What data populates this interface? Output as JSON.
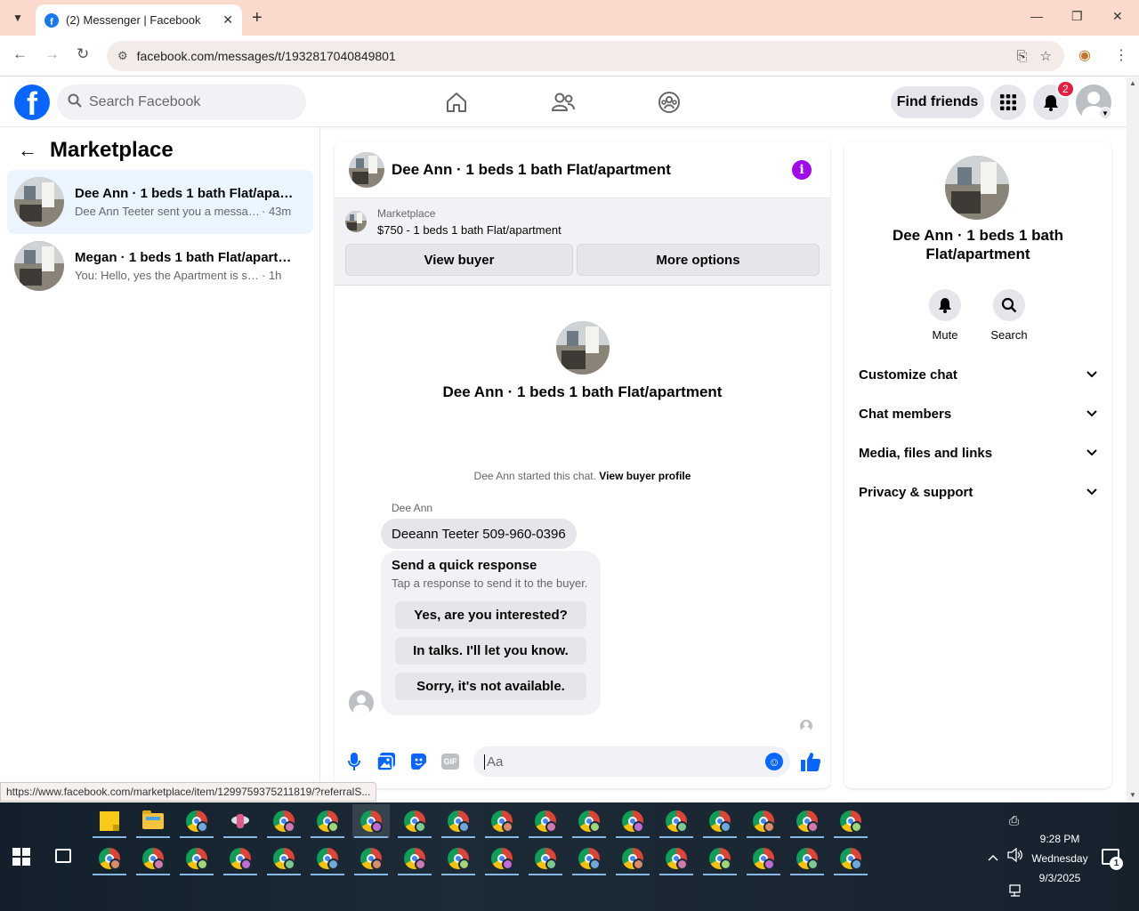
{
  "browser": {
    "tab_title": "(2) Messenger | Facebook",
    "url": "facebook.com/messages/t/1932817040849801",
    "status_url": "https://www.facebook.com/marketplace/item/1299759375211819/?referralS..."
  },
  "header": {
    "search_placeholder": "Search Facebook",
    "find_friends_label": "Find friends",
    "notification_count": "2",
    "logo_letter": "f"
  },
  "sidebar": {
    "title": "Marketplace",
    "conversations": [
      {
        "name": "Dee Ann · 1 beds 1 bath Flat/apart...",
        "snippet": "Dee Ann Teeter sent you a message ...",
        "time": "· 43m"
      },
      {
        "name": "Megan · 1 beds 1 bath Flat/apartm...",
        "snippet": "You: Hello, yes the Apartment is still a...",
        "time": "· 1h"
      }
    ]
  },
  "chat": {
    "title": "Dee Ann · 1 beds 1 bath Flat/apartment",
    "marketplace_label": "Marketplace",
    "listing": "$750 - 1 beds 1 bath Flat/apartment",
    "view_buyer_label": "View buyer",
    "more_options_label": "More options",
    "center_name": "Dee Ann · 1 beds 1 bath Flat/apartment",
    "started_text": "Dee Ann started this chat.",
    "view_buyer_profile_label": "View buyer profile",
    "sender_name": "Dee Ann",
    "message": "Deeann Teeter 509-960-0396",
    "quick_response_title": "Send a quick response",
    "quick_response_subtitle": "Tap a response to send it to the buyer.",
    "quick_responses": [
      "Yes, are you interested?",
      "In talks. I'll let you know.",
      "Sorry, it's not available."
    ],
    "composer_placeholder": "Aa",
    "gif_label": "GIF"
  },
  "info_panel": {
    "name": "Dee Ann · 1 beds 1 bath Flat/apartment",
    "mute_label": "Mute",
    "search_label": "Search",
    "sections": [
      "Customize chat",
      "Chat members",
      "Media, files and links",
      "Privacy & support"
    ]
  },
  "taskbar": {
    "time": "9:28 PM",
    "day": "Wednesday",
    "date": "9/3/2025",
    "notification_count": "1"
  },
  "colors": {
    "facebook_blue": "#0866ff",
    "info_purple": "#a10aea",
    "badge_red": "#e41e3f",
    "tabstrip": "#fbd9cc"
  }
}
